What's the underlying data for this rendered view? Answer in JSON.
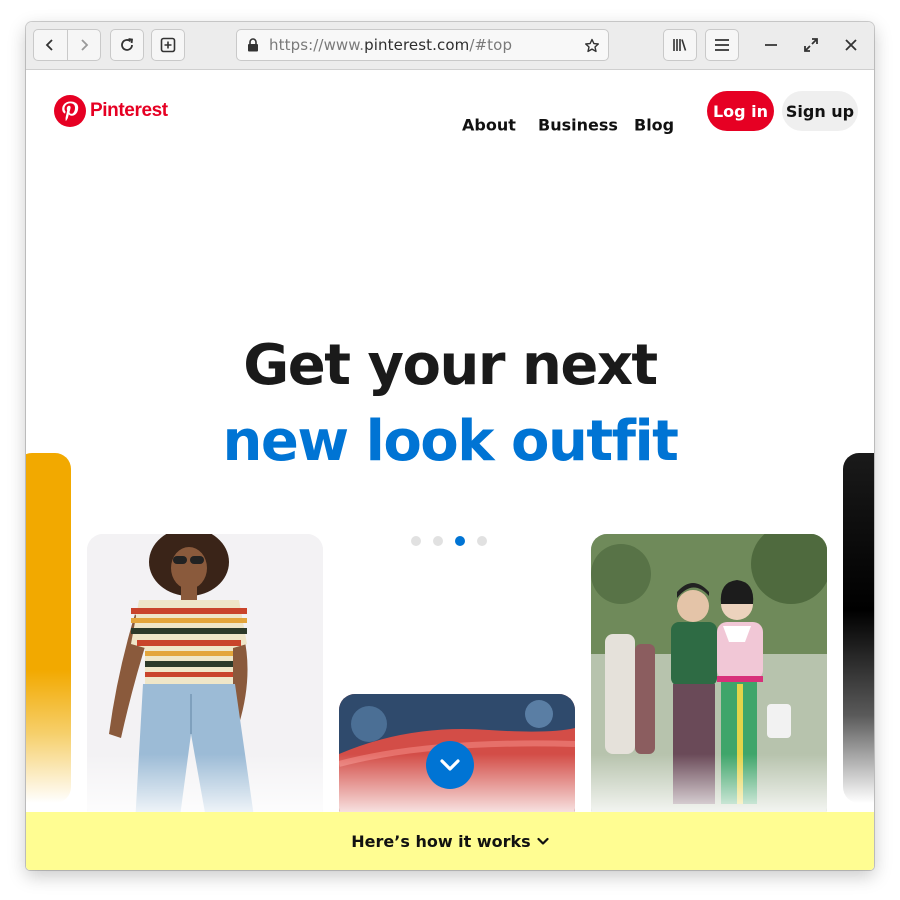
{
  "browser": {
    "url_scheme": "https://www.",
    "url_host": "pinterest.com",
    "url_path": "/#top",
    "icons": [
      "back-icon",
      "forward-icon",
      "reload-icon",
      "new-tab-icon",
      "lock-icon",
      "star-icon",
      "library-icon",
      "menu-icon",
      "minimize-icon",
      "maximize-icon",
      "close-icon"
    ]
  },
  "header": {
    "logo_text": "Pinterest",
    "nav": {
      "about": "About",
      "business": "Business",
      "blog": "Blog"
    },
    "login": "Log in",
    "signup": "Sign up"
  },
  "hero": {
    "line1": "Get your next",
    "line2": "new look outfit",
    "carousel_dots": 4,
    "active_dot": 3
  },
  "footer_bar": {
    "label": "Here’s how it works"
  },
  "colors": {
    "brand_red": "#e60023",
    "accent_blue": "#0074d4",
    "banner_yellow": "#fffd92"
  }
}
